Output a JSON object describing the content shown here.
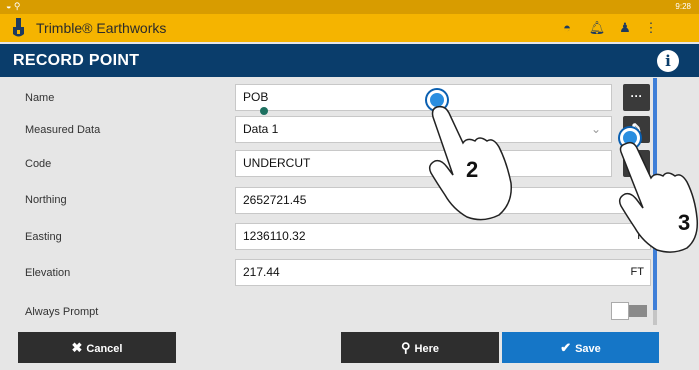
{
  "status": {
    "time": "9:28"
  },
  "app": {
    "title": "Trimble® Earthworks"
  },
  "header": {
    "title": "RECORD POINT"
  },
  "form": {
    "name": {
      "label": "Name",
      "value": "POB"
    },
    "measured_data": {
      "label": "Measured Data",
      "value": "Data 1"
    },
    "code": {
      "label": "Code",
      "value": "UNDERCUT"
    },
    "northing": {
      "label": "Northing",
      "value": "2652721.45"
    },
    "easting": {
      "label": "Easting",
      "value": "1236110.32",
      "unit": "F"
    },
    "elevation": {
      "label": "Elevation",
      "value": "217.44",
      "unit": "FT"
    },
    "always_prompt": {
      "label": "Always Prompt",
      "enabled": false
    }
  },
  "footer": {
    "cancel": "Cancel",
    "here": "Here",
    "save": "Save"
  },
  "annotations": {
    "step_2": "2",
    "step_3": "3"
  },
  "colors": {
    "brand": "#f5b400",
    "header": "#0a3d6b",
    "save": "#1576c7",
    "dark_button": "#2e2e2e",
    "scroll": "#3f7fd8"
  }
}
